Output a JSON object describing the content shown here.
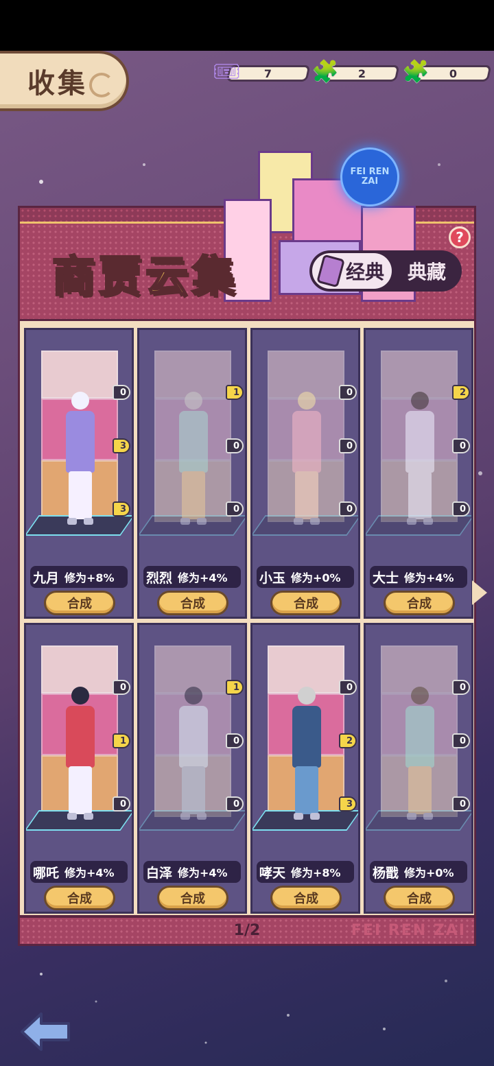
{
  "header": {
    "title": "收集"
  },
  "resources": [
    {
      "icon": "ticket-icon",
      "value": "7"
    },
    {
      "icon": "puzzle-purple-icon",
      "value": "2"
    },
    {
      "icon": "puzzle-orange-icon",
      "value": "0"
    }
  ],
  "banner": {
    "title": "商贾云集",
    "neon_sign": "FEI REN ZAI",
    "toggle_on": "经典",
    "toggle_off": "典藏",
    "help": "?"
  },
  "cards": [
    {
      "name": "九月",
      "bonus": "修为+8%",
      "button": "合成",
      "badges": [
        "0",
        "3",
        "3"
      ],
      "badge_gold": [
        false,
        true,
        true
      ]
    },
    {
      "name": "烈烈",
      "bonus": "修为+4%",
      "button": "合成",
      "badges": [
        "1",
        "0",
        "0"
      ],
      "badge_gold": [
        true,
        false,
        false
      ]
    },
    {
      "name": "小玉",
      "bonus": "修为+0%",
      "button": "合成",
      "badges": [
        "0",
        "0",
        "0"
      ],
      "badge_gold": [
        false,
        false,
        false
      ]
    },
    {
      "name": "大士",
      "bonus": "修为+4%",
      "button": "合成",
      "badges": [
        "2",
        "0",
        "0"
      ],
      "badge_gold": [
        true,
        false,
        false
      ]
    },
    {
      "name": "哪吒",
      "bonus": "修为+4%",
      "button": "合成",
      "badges": [
        "0",
        "1",
        "0"
      ],
      "badge_gold": [
        false,
        true,
        false
      ]
    },
    {
      "name": "白泽",
      "bonus": "修为+4%",
      "button": "合成",
      "badges": [
        "1",
        "0",
        "0"
      ],
      "badge_gold": [
        true,
        false,
        false
      ]
    },
    {
      "name": "哮天",
      "bonus": "修为+8%",
      "button": "合成",
      "badges": [
        "0",
        "2",
        "3"
      ],
      "badge_gold": [
        false,
        true,
        true
      ]
    },
    {
      "name": "杨戬",
      "bonus": "修为+0%",
      "button": "合成",
      "badges": [
        "0",
        "0",
        "0"
      ],
      "badge_gold": [
        false,
        false,
        false
      ]
    }
  ],
  "pager": {
    "page": "1/2",
    "watermark": "FEI REN ZAI"
  }
}
